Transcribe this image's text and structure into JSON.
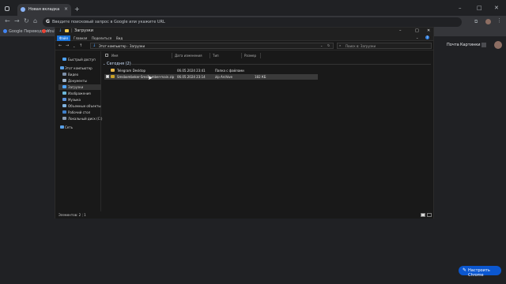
{
  "browser": {
    "tab_title": "Новая вкладка",
    "tab_close": "×",
    "new_tab": "+",
    "window_controls": [
      "–",
      "□",
      "✕"
    ],
    "omnibox_placeholder": "Введите поисковый запрос в Google или укажите URL",
    "bookmarks": [
      "Google Переводчик",
      "YouT"
    ],
    "ntp_links": [
      "Почта",
      "Картинки"
    ],
    "customize_label": "Настроить Chrome"
  },
  "explorer": {
    "title": "Загрузки",
    "window_controls": [
      "–",
      "□",
      "✕"
    ],
    "ribbon_tabs": [
      "Файл",
      "Главная",
      "Поделиться",
      "Вид"
    ],
    "breadcrumb": [
      "Этот компьютер",
      "Загрузки"
    ],
    "search_placeholder": "Поиск в: Загрузки",
    "nav": {
      "quick_access": "Быстрый доступ",
      "this_pc": "Этот компьютер",
      "items": [
        "Видео",
        "Документы",
        "Загрузки",
        "Изображения",
        "Музыка",
        "Объемные объекты",
        "Рабочий стол",
        "Локальный диск (C:)"
      ],
      "network": "Сеть"
    },
    "columns": [
      "Имя",
      "Дата изменения",
      "Тип",
      "Размер"
    ],
    "group_label": "Сегодня (2)",
    "files": [
      {
        "name": "Telegram Desktop",
        "date": "06.05.2024 23:41",
        "type": "Папка с файлами",
        "size": ""
      },
      {
        "name": "Smsbombeker-SmsBomber-main.zip",
        "date": "06.05.2024 23:14",
        "type": "zip Archive",
        "size": "182 КБ"
      }
    ],
    "status": "Элементов: 2",
    "status_selected": "1"
  },
  "colors": {
    "accent": "#1a73d9",
    "folder": "#e8b84a",
    "zip": "#c9a227",
    "chrome_blue": "#0b57d0"
  }
}
